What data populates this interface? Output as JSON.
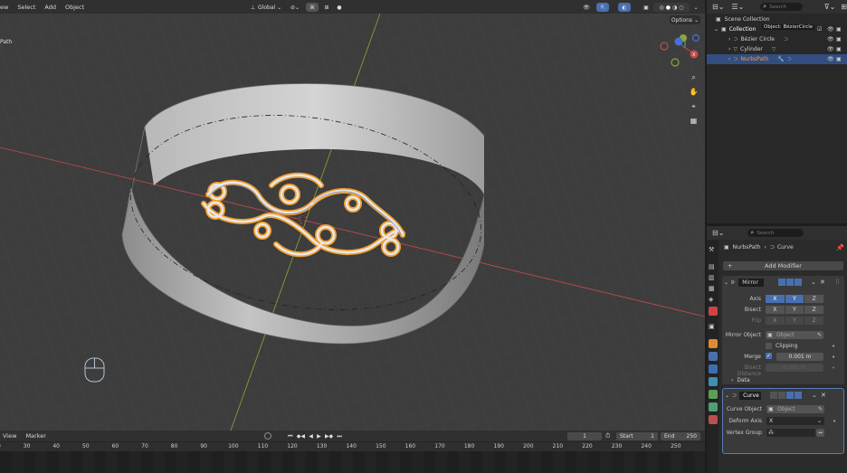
{
  "viewport": {
    "menu": [
      "ew",
      "Select",
      "Add",
      "Object"
    ],
    "overlay_label": "Path",
    "transform_orientation": "Global",
    "options_label": "Options",
    "search_placeholder": "Search"
  },
  "outliner": {
    "scene_collection": "Scene Collection",
    "collection": "Collection",
    "tooltip": "Object: BézierCircle",
    "items": [
      {
        "label": "Bézier Circle",
        "icon": "curve-icon"
      },
      {
        "label": "Cylinder",
        "icon": "mesh-icon"
      },
      {
        "label": "NurbsPath",
        "icon": "curve-icon",
        "selected": true
      }
    ]
  },
  "properties": {
    "search_placeholder": "Search",
    "breadcrumb": {
      "object": "NurbsPath",
      "data": "Curve"
    },
    "add_modifier": "Add Modifier",
    "mirror": {
      "name": "Mirror",
      "axis_label": "Axis",
      "bisect_label": "Bisect",
      "flip_label": "Flip",
      "axes": [
        "X",
        "Y",
        "Z"
      ],
      "mirror_object_label": "Mirror Object",
      "object_placeholder": "Object",
      "clipping_label": "Clipping",
      "merge_label": "Merge",
      "merge_value": "0.001 m",
      "bisect_distance_label": "Bisect Distance",
      "bisect_distance_value": "0.001 m",
      "data_label": "Data"
    },
    "curve": {
      "name": "Curve",
      "curve_object_label": "Curve Object",
      "object_placeholder": "Object",
      "deform_axis_label": "Deform Axis",
      "deform_axis_value": "X",
      "vertex_group_label": "Vertex Group"
    }
  },
  "timeline": {
    "menu": [
      "View",
      "Marker"
    ],
    "current_frame": "1",
    "start_label": "Start",
    "start_value": "1",
    "end_label": "End",
    "end_value": "250",
    "ticks": [
      "20",
      "30",
      "40",
      "50",
      "60",
      "70",
      "80",
      "90",
      "100",
      "110",
      "120",
      "130",
      "140",
      "150",
      "160",
      "170",
      "180",
      "190",
      "200",
      "210",
      "220",
      "230",
      "240",
      "250"
    ]
  },
  "colors": {
    "accent": "#4a6fb0",
    "selection_orange": "#f0a030",
    "x_axis": "#c84a4a",
    "y_axis": "#8aa83a"
  }
}
